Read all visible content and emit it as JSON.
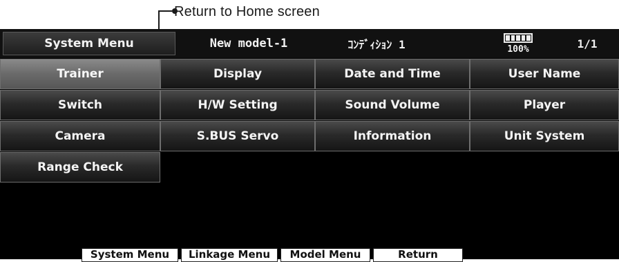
{
  "callout": {
    "text": "Return to Home screen"
  },
  "header": {
    "menu_title": "System Menu",
    "model_name": "New model-1",
    "condition": "ｺﾝﾃﾞｨｼｮﾝ 1",
    "battery_level": "100%",
    "page": "1/1"
  },
  "menu": {
    "items": [
      {
        "label": "Trainer",
        "active": true
      },
      {
        "label": "Display"
      },
      {
        "label": "Date and Time"
      },
      {
        "label": "User Name"
      },
      {
        "label": "Switch"
      },
      {
        "label": "H/W Setting"
      },
      {
        "label": "Sound Volume"
      },
      {
        "label": "Player"
      },
      {
        "label": "Camera"
      },
      {
        "label": "S.BUS Servo"
      },
      {
        "label": "Information"
      },
      {
        "label": "Unit System"
      },
      {
        "label": "Range Check"
      }
    ]
  },
  "footer": {
    "tabs": [
      "System Menu",
      "Linkage Menu",
      "Model Menu",
      "Return"
    ]
  }
}
